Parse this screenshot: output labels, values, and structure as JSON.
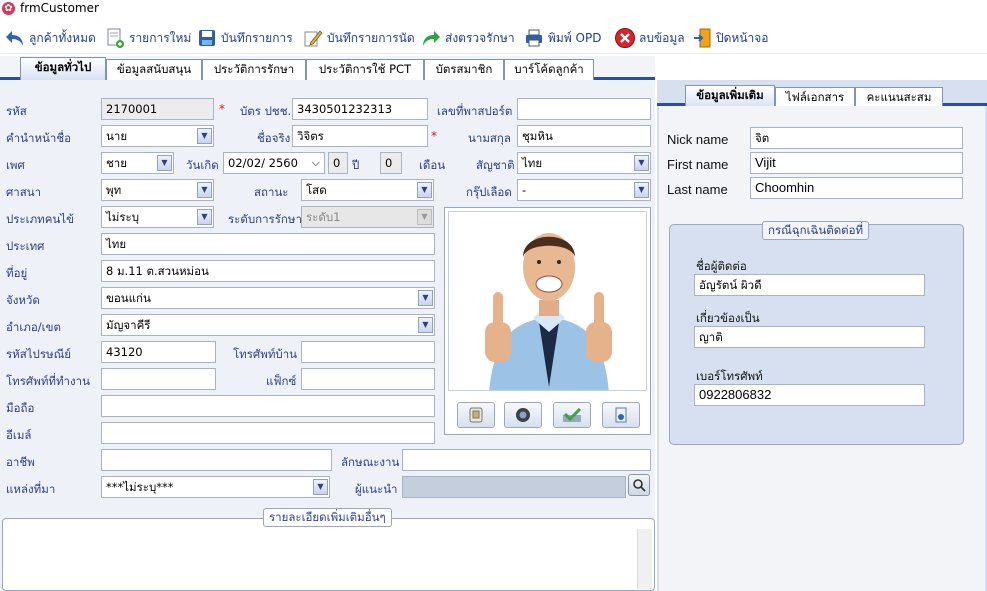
{
  "window": {
    "title": "frmCustomer"
  },
  "toolbar": {
    "buttons": [
      {
        "label": "ลูกค้าทั้งหมด",
        "icon": "back-arrow-icon"
      },
      {
        "label": "รายการใหม่",
        "icon": "new-document-icon"
      },
      {
        "label": "บันทึกรายการ",
        "icon": "save-disk-icon"
      },
      {
        "label": "บันทึกรายการนัด",
        "icon": "pencil-icon"
      },
      {
        "label": "ส่งตรวจรักษา",
        "icon": "forward-arrow-icon"
      },
      {
        "label": "พิมพ์ OPD",
        "icon": "printer-icon"
      },
      {
        "label": "ลบข้อมูล",
        "icon": "delete-icon"
      },
      {
        "label": "ปิดหน้าจอ",
        "icon": "exit-door-icon"
      }
    ]
  },
  "tabs": [
    "ข้อมูลทั่วไป",
    "ข้อมูลสนับสนุน",
    "ประวัติการรักษา",
    "ประวัติการใช้ PCT",
    "บัตรสมาชิก",
    "บาร์โค้ดลูกค้า"
  ],
  "form": {
    "code_label": "รหัส",
    "code_value": "2170001",
    "idcard_label": "บัตร ปชช.",
    "idcard_value": "3430501232313",
    "passport_label": "เลขที่พาสปอร์ต",
    "passport_value": "",
    "prefix_label": "คำนำหน้าชื่อ",
    "prefix_value": "นาย",
    "firstname_label": "ชื่อจริง",
    "firstname_value": "วิจิตร",
    "lastname_label": "นามสกุล",
    "lastname_value": "ชุมหิน",
    "sex_label": "เพศ",
    "sex_value": "ชาย",
    "birth_label": "วันเกิด",
    "birth_value": "02/02/  2560",
    "age_years": "0",
    "age_years_unit": "ปี",
    "age_months": "0",
    "age_months_unit": "เดือน",
    "nation_label": "สัญชาติ",
    "nation_value": "ไทย",
    "religion_label": "ศาสนา",
    "religion_value": "พุท",
    "status_label": "สถานะ",
    "status_value": "โสด",
    "blood_label": "กรุ๊ปเลือด",
    "blood_value": "-",
    "ptype_label": "ประเภทคนไข้",
    "ptype_value": "ไม่ระบุ",
    "level_label": "ระดับการรักษา",
    "level_value": "ระดับ1",
    "country_label": "ประเทศ",
    "country_value": "ไทย",
    "address_label": "ที่อยู่",
    "address_value": "8 ม.11 ต.สวนหม่อน",
    "province_label": "จังหวัด",
    "province_value": "ขอนแก่น",
    "district_label": "อำเภอ/เขต",
    "district_value": "มัญจาคีรี",
    "zip_label": "รหัสไปรษณีย์",
    "zip_value": "43120",
    "homephone_label": "โทรศัพท์บ้าน",
    "homephone_value": "",
    "workphone_label": "โทรศัพท์ที่ทำงาน",
    "workphone_value": "",
    "fax_label": "แฟ็กซ์",
    "fax_value": "",
    "mobile_label": "มือถือ",
    "mobile_value": "",
    "email_label": "อีเมล์",
    "email_value": "",
    "career_label": "อาชีพ",
    "career_value": "",
    "jobdesc_label": "ลักษณะงาน",
    "jobdesc_value": "",
    "source_label": "แหล่งที่มา",
    "source_value": "***ไม่ระบุ***",
    "referrer_label": "ผู้แนะนำ",
    "referrer_value": "",
    "extra_title": "รายละเอียดเพิ่มเติมอื่นๆ"
  },
  "right_tabs": [
    "ข้อมูลเพิ่มเติม",
    "ไฟล์เอกสาร",
    "คะแนนสะสม"
  ],
  "extra": {
    "nick_label": "Nick name",
    "nick_value": "จิต",
    "first_label": "First name",
    "first_value": "Vijit",
    "last_label": "Last name",
    "last_value": "Choomhin"
  },
  "emergency": {
    "title": "กรณีฉุกเฉินติดต่อที่",
    "contact_label": "ชื่อผู้ติดต่อ",
    "contact_value": "อัญรัตน์ ผิวดี",
    "relation_label": "เกี่ยวข้องเป็น",
    "relation_value": "ญาติ",
    "phone_label": "เบอร์โทรศัพท์",
    "phone_value": "0922806832"
  }
}
